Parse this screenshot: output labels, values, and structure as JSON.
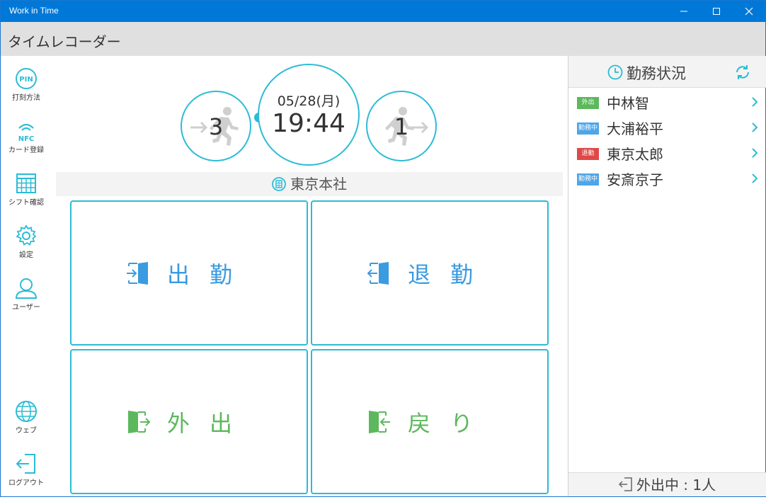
{
  "window": {
    "title": "Work in Time"
  },
  "header": {
    "title": "タイムレコーダー"
  },
  "sidebar": {
    "items": [
      {
        "label": "打刻方法",
        "icon": "pin-icon",
        "icon_text": "PIN"
      },
      {
        "label": "カード登録",
        "icon": "nfc-icon",
        "icon_text": "NFC"
      },
      {
        "label": "シフト確認",
        "icon": "calendar-grid-icon"
      },
      {
        "label": "設定",
        "icon": "gear-icon"
      },
      {
        "label": "ユーザー",
        "icon": "user-icon"
      },
      {
        "label": "ウェブ",
        "icon": "globe-icon"
      },
      {
        "label": "ログアウト",
        "icon": "logout-icon"
      }
    ]
  },
  "clock": {
    "date": "05/28(月)",
    "time": "19:44",
    "in_count": "3",
    "out_count": "1"
  },
  "location": {
    "name": "東京本社"
  },
  "buttons": {
    "clock_in": "出勤",
    "clock_out": "退勤",
    "go_out": "外出",
    "return": "戻り"
  },
  "status_panel": {
    "title": "勤務状況",
    "rows": [
      {
        "badge": "外出",
        "badge_color": "#5cb85c",
        "name": "中林智"
      },
      {
        "badge": "勤務中",
        "badge_color": "#4da6e8",
        "name": "大浦裕平"
      },
      {
        "badge": "退勤",
        "badge_color": "#e04848",
        "name": "東京太郎"
      },
      {
        "badge": "勤務中",
        "badge_color": "#4da6e8",
        "name": "安斎京子"
      }
    ],
    "footer": "外出中 : 1人"
  },
  "colors": {
    "accent": "#2bbcd6",
    "blue": "#3a9be0",
    "green": "#5cb85c",
    "titlebar": "#0078d7"
  }
}
